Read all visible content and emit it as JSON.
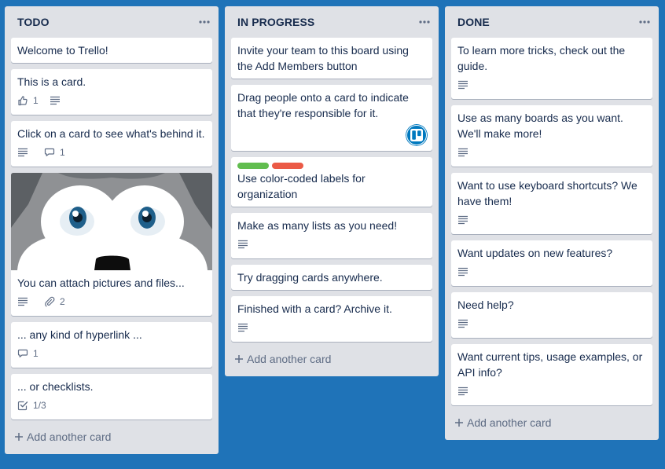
{
  "lists": [
    {
      "title": "TODO",
      "cards": [
        {
          "title": "Welcome to Trello!"
        },
        {
          "title": "This is a card.",
          "likes": "1"
        },
        {
          "title": "Click on a card to see what's behind it.",
          "comments": "1"
        },
        {
          "title": "You can attach pictures and files...",
          "attachments": "2"
        },
        {
          "title": "... any kind of hyperlink ...",
          "comments": "1"
        },
        {
          "title": "... or checklists.",
          "checklist": "1/3"
        }
      ],
      "add_label": "Add another card"
    },
    {
      "title": "IN PROGRESS",
      "cards": [
        {
          "title": "Invite your team to this board using the Add Members button"
        },
        {
          "title": "Drag people onto a card to indicate that they're responsible for it."
        },
        {
          "title": "Use color-coded labels for organization"
        },
        {
          "title": "Make as many lists as you need!"
        },
        {
          "title": "Try dragging cards anywhere."
        },
        {
          "title": "Finished with a card? Archive it."
        }
      ],
      "add_label": "Add another card"
    },
    {
      "title": "DONE",
      "cards": [
        {
          "title": "To learn more tricks, check out the guide."
        },
        {
          "title": "Use as many boards as you want. We'll make more!"
        },
        {
          "title": "Want to use keyboard shortcuts? We have them!"
        },
        {
          "title": "Want updates on new features?"
        },
        {
          "title": "Need help?"
        },
        {
          "title": "Want current tips, usage examples, or API info?"
        }
      ],
      "add_label": "Add another card"
    }
  ],
  "colors": {
    "board_background": "#1f73b8",
    "list_background": "#dfe1e6",
    "label_green": "#61bd4f",
    "label_red": "#eb5a46"
  }
}
